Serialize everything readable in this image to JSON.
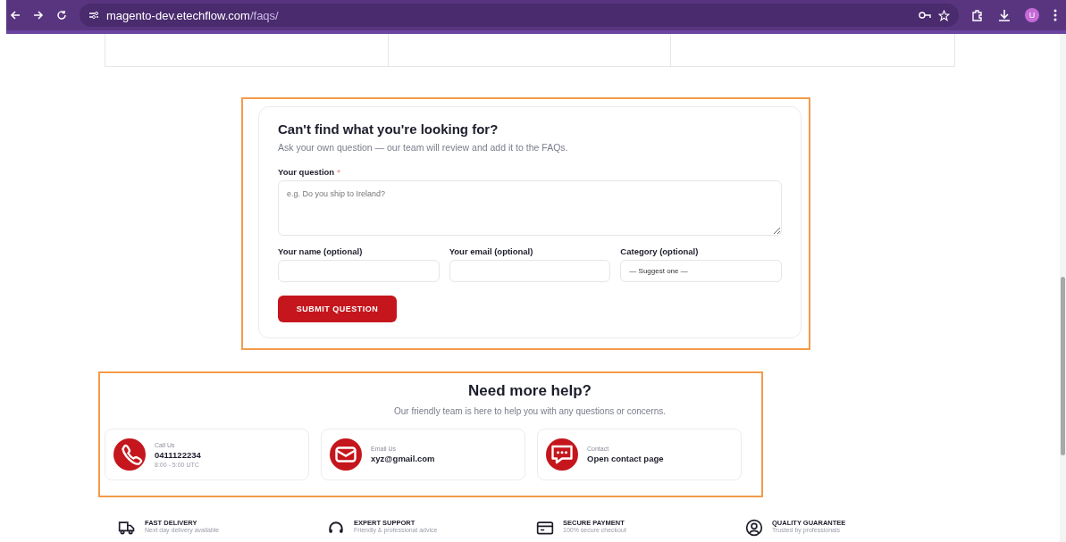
{
  "browser": {
    "url_host": "magento-dev.etechflow.com",
    "url_path": "/faqs/",
    "profile_initial": "U"
  },
  "question_form": {
    "title": "Can't find what you're looking for?",
    "subtitle": "Ask your own question — our team will review and add it to the FAQs.",
    "question_label": "Your question",
    "required_mark": "*",
    "question_placeholder": "e.g. Do you ship to Ireland?",
    "fields": [
      {
        "kind": "text",
        "label": "Your name (optional)"
      },
      {
        "kind": "text",
        "label": "Your email (optional)"
      },
      {
        "kind": "select",
        "label": "Category (optional)",
        "value": "— Suggest one —"
      }
    ],
    "submit_button": "SUBMIT QUESTION"
  },
  "help": {
    "title": "Need more help?",
    "subtitle": "Our friendly team is here to help you with any questions or concerns.",
    "contacts": [
      {
        "kind": "phone",
        "label": "Call Us",
        "value": "0411122234",
        "note": "8:00 - 5:00 UTC"
      },
      {
        "kind": "email",
        "label": "Email Us",
        "value": "xyz@gmail.com"
      },
      {
        "kind": "chat",
        "label": "Contact",
        "value": "Open contact page"
      }
    ]
  },
  "features": [
    {
      "kind": "truck",
      "title": "FAST DELIVERY",
      "text": "Next day delivery available"
    },
    {
      "kind": "headset",
      "title": "EXPERT SUPPORT",
      "text": "Friendly & professional advice"
    },
    {
      "kind": "card",
      "title": "SECURE PAYMENT",
      "text": "100% secure checkout"
    },
    {
      "kind": "badge",
      "title": "QUALITY GUARANTEE",
      "text": "Trusted by professionals"
    }
  ]
}
